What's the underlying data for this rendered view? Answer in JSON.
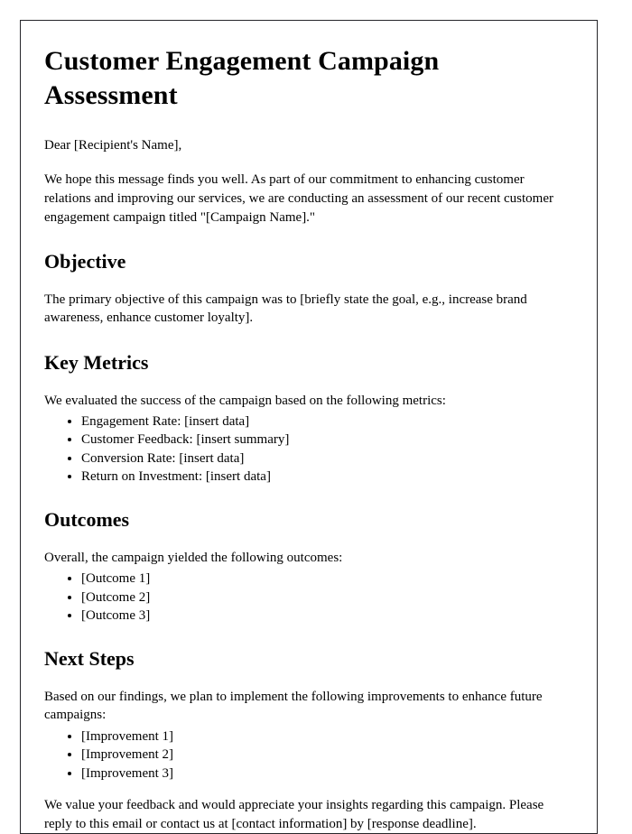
{
  "document": {
    "title": "Customer Engagement Campaign Assessment",
    "salutation": "Dear [Recipient's Name],",
    "intro_paragraph": "We hope this message finds you well. As part of our commitment to enhancing customer relations and improving our services, we are conducting an assessment of our recent customer engagement campaign titled \"[Campaign Name].\"",
    "closing_paragraph": "We value your feedback and would appreciate your insights regarding this campaign. Please reply to this email or contact us at [contact information] by [response deadline].",
    "sections": {
      "objective": {
        "heading": "Objective",
        "paragraph": "The primary objective of this campaign was to [briefly state the goal, e.g., increase brand awareness, enhance customer loyalty]."
      },
      "key_metrics": {
        "heading": "Key Metrics",
        "paragraph": "We evaluated the success of the campaign based on the following metrics:",
        "items": [
          "Engagement Rate: [insert data]",
          "Customer Feedback: [insert summary]",
          "Conversion Rate: [insert data]",
          "Return on Investment: [insert data]"
        ]
      },
      "outcomes": {
        "heading": "Outcomes",
        "paragraph": "Overall, the campaign yielded the following outcomes:",
        "items": [
          "[Outcome 1]",
          "[Outcome 2]",
          "[Outcome 3]"
        ]
      },
      "next_steps": {
        "heading": "Next Steps",
        "paragraph": "Based on our findings, we plan to implement the following improvements to enhance future campaigns:",
        "items": [
          "[Improvement 1]",
          "[Improvement 2]",
          "[Improvement 3]"
        ]
      }
    }
  }
}
